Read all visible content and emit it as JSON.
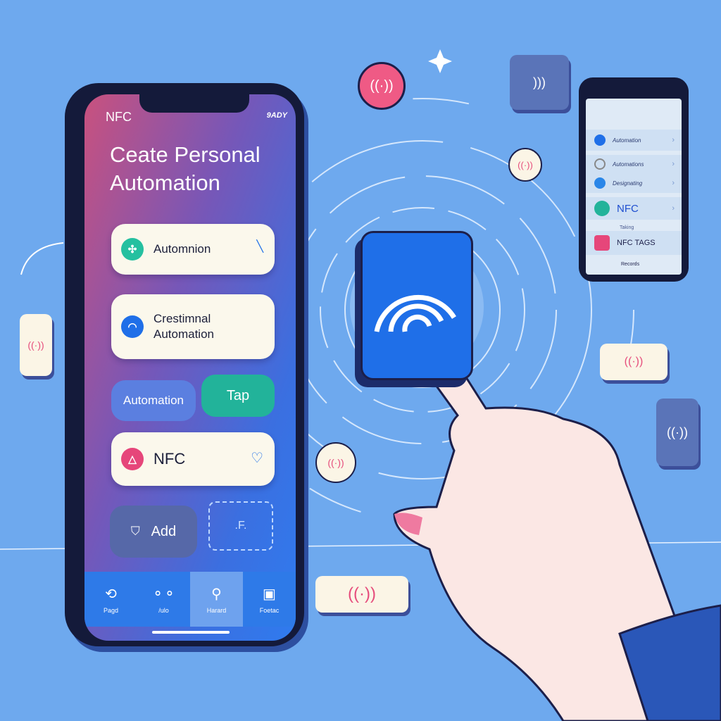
{
  "main_phone": {
    "status_label": "NFC",
    "status_right": "9ADY",
    "title": "Ceate Personal Automation",
    "cards": [
      {
        "label": "Automnion",
        "icon": "grid-icon",
        "color": "#25c0a0"
      },
      {
        "label": "Crestimnal Automation",
        "icon": "wifi-icon",
        "color": "#1f6fe8"
      }
    ],
    "buttons": {
      "automation": "Automation",
      "tap": "Tap",
      "add": "Add"
    },
    "nfc_card": {
      "label": "NFC",
      "icon": "warning-icon",
      "color": "#e6467a"
    },
    "tabs": [
      {
        "label": "Pagd",
        "icon": "shortcut-icon"
      },
      {
        "label": "/ulo",
        "icon": "nodes-icon"
      },
      {
        "label": "Harard",
        "icon": "pin-icon"
      },
      {
        "label": "Foetac",
        "icon": "tag-icon"
      }
    ]
  },
  "side_phone": {
    "rows": [
      {
        "label": "Automation",
        "color": "#1f6fe8"
      },
      {
        "label": "Automations",
        "color": "#888888"
      },
      {
        "label": "Designating",
        "color": "#2a86e8"
      },
      {
        "label": "NFC",
        "color": "#22b39a"
      }
    ],
    "section_label": "NFC TAGS",
    "section_sub": "Taking",
    "footer": "Records"
  },
  "colors": {
    "background": "#6ea9ee",
    "accent": "#1f6fe8",
    "nfc_pink": "#e64d7c",
    "teal": "#25c0a0"
  }
}
